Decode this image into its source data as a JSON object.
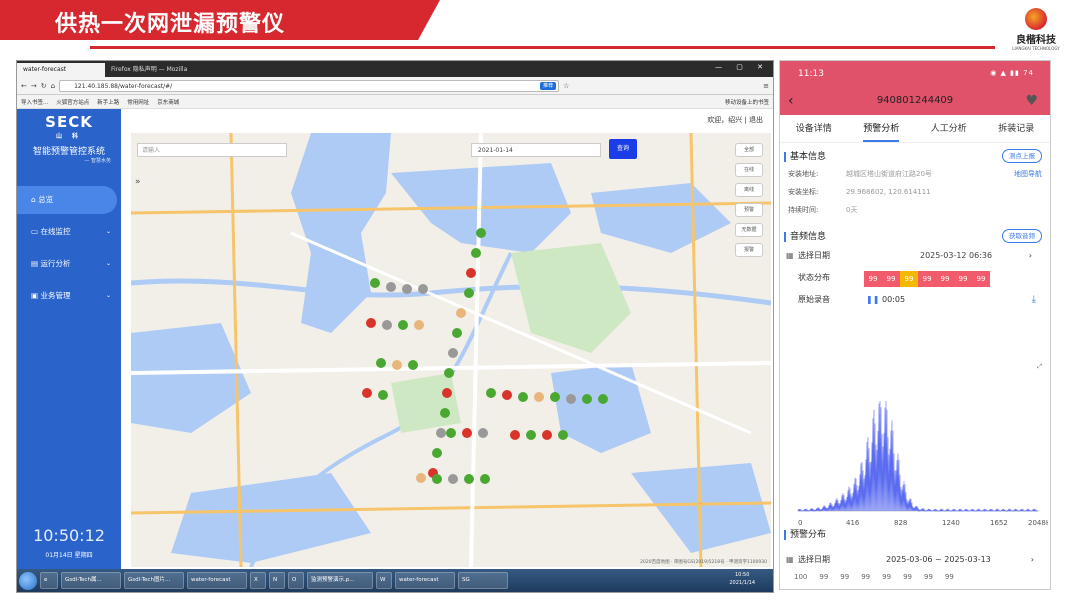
{
  "slide": {
    "title": "供热一次网泄漏预警仪",
    "logo_text": "良楷科技",
    "logo_sub": "LIANGKAI TECHNOLOGY",
    "accent": "#d7282f"
  },
  "browser": {
    "tabs": [
      "water-forecast",
      "Firefox 隐私声明 — Mozilla"
    ],
    "url": "121.40.185.88/water-forecast/#/",
    "recommend": "推荐",
    "bookmarks": [
      "导入书签...",
      "火狐官方站点",
      "新手上路",
      "常用网址",
      "京东商城"
    ],
    "bookmark_right": "移动设备上的书签"
  },
  "app": {
    "logo": "SECK",
    "logo_sub": "山 科",
    "title": "智能预警管控系统",
    "subtitle": "— 智慧水务",
    "nav": [
      {
        "label": "总览",
        "icon": "home-icon",
        "active": true
      },
      {
        "label": "在线监控",
        "icon": "monitor-icon",
        "active": false
      },
      {
        "label": "运行分析",
        "icon": "analysis-icon",
        "active": false
      },
      {
        "label": "业务管理",
        "icon": "business-icon",
        "active": false
      }
    ],
    "clock": "10:50:12",
    "date": "01月14日 星期四",
    "user": "欢迎，绍兴 | 退出",
    "map": {
      "search_placeholder": "请输入",
      "date_value": "2021-01-14",
      "search_button": "查询",
      "controls": [
        "全部",
        "在线",
        "离线",
        "预警",
        "无数据",
        "报警"
      ],
      "footer": "2020百度地图 · 审图号GS(2019)5218号 · 甲测资字1100930"
    }
  },
  "taskbar": {
    "items": [
      "Gsdl-Tech属...",
      "Gsdl-Tech图片...",
      "water-forecast",
      "X",
      "N",
      "O",
      "监测预警演示.p...",
      "W",
      "water-forecast",
      "SG"
    ],
    "time": "10:50",
    "date": "2021/1/14"
  },
  "phone": {
    "time": "11:13",
    "battery": "74",
    "device_id": "940801244409",
    "tabs": [
      "设备详情",
      "预警分析",
      "人工分析",
      "拆装记录"
    ],
    "active_tab": "预警分析",
    "basic_info": "基本信息",
    "report_button": "测点上报",
    "address_label": "安装地址:",
    "address_value": "越城区塔山街道府江路20号",
    "map_nav": "地图导航",
    "coord_label": "安装坐标:",
    "coord_value": "29.968602, 120.614111",
    "duration_label": "持续时间:",
    "duration_value": "0天",
    "audio_info": "音频信息",
    "get_audio": "获取音频",
    "select_date_label": "选择日期",
    "select_date_value": "2025-03-12 06:36",
    "status_label": "状态分布",
    "status_values": [
      "99",
      "99",
      "99",
      "99",
      "99",
      "99",
      "99"
    ],
    "status_colors": [
      "#f25b6b",
      "#f25b6b",
      "#f5b800",
      "#f25b6b",
      "#f25b6b",
      "#f25b6b",
      "#f25b6b"
    ],
    "recording_label": "原始录音",
    "recording_time": "00:05",
    "spectrum_ticks": [
      "0",
      "416",
      "828",
      "1240",
      "1652",
      "2048Hz"
    ],
    "warning_dist": "预警分布",
    "warning_date_label": "选择日期",
    "warning_date_value": "2025-03-06 ~ 2025-03-13",
    "warning_axis": "100",
    "warning_values": [
      "99",
      "99",
      "99",
      "99",
      "99",
      "99",
      "99"
    ]
  }
}
